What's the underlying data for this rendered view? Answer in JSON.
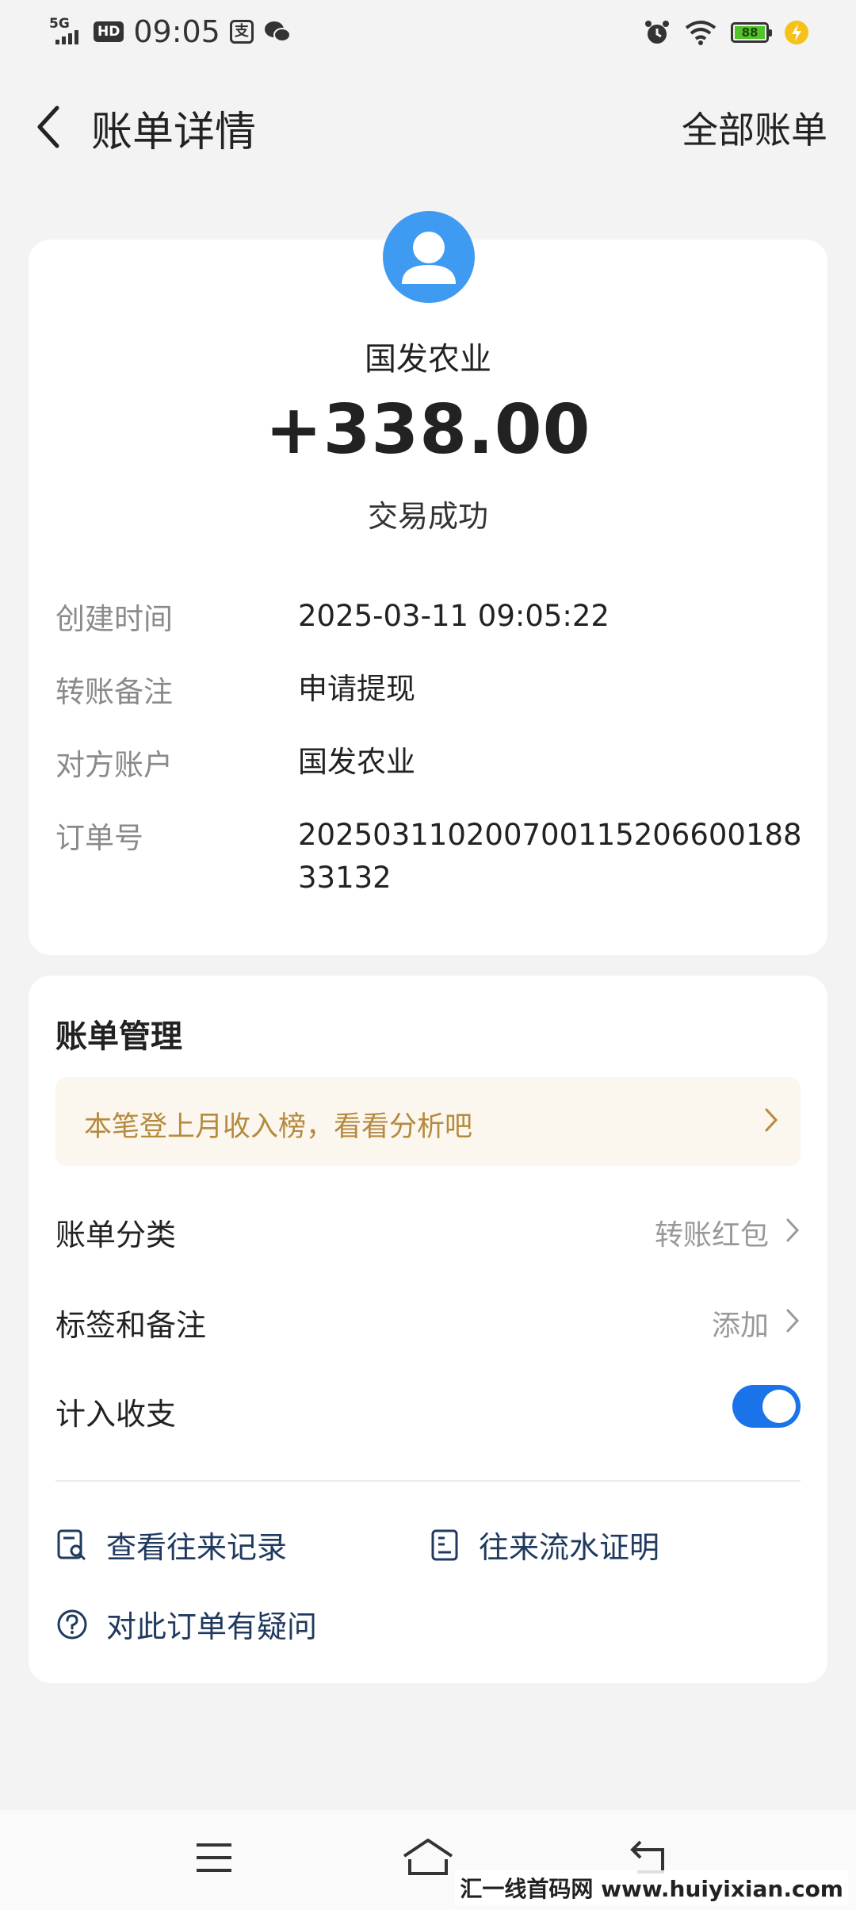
{
  "status_bar": {
    "network": "5G",
    "hd": "HD",
    "time": "09:05",
    "battery": "88"
  },
  "nav": {
    "title": "账单详情",
    "right_link": "全部账单"
  },
  "transaction": {
    "merchant": "国发农业",
    "amount": "+338.00",
    "status": "交易成功",
    "details": [
      {
        "label": "创建时间",
        "value": "2025-03-11 09:05:22"
      },
      {
        "label": "转账备注",
        "value": "申请提现"
      },
      {
        "label": "对方账户",
        "value": "国发农业"
      },
      {
        "label": "订单号",
        "value": "20250311020070011520660018833132"
      }
    ]
  },
  "management": {
    "title": "账单管理",
    "banner": "本笔登上月收入榜，看看分析吧",
    "rows": [
      {
        "label": "账单分类",
        "value": "转账红包"
      },
      {
        "label": "标签和备注",
        "value": "添加"
      },
      {
        "label": "计入收支",
        "toggle_on": true
      }
    ],
    "links": {
      "records": "查看往来记录",
      "proof": "往来流水证明",
      "question": "对此订单有疑问"
    }
  },
  "watermark": "汇一线首码网 www.huiyixian.com",
  "colors": {
    "accent": "#1a73e8",
    "avatar": "#3f9bf2",
    "banner_text": "#b58a3c",
    "link_text": "#203a5f"
  }
}
